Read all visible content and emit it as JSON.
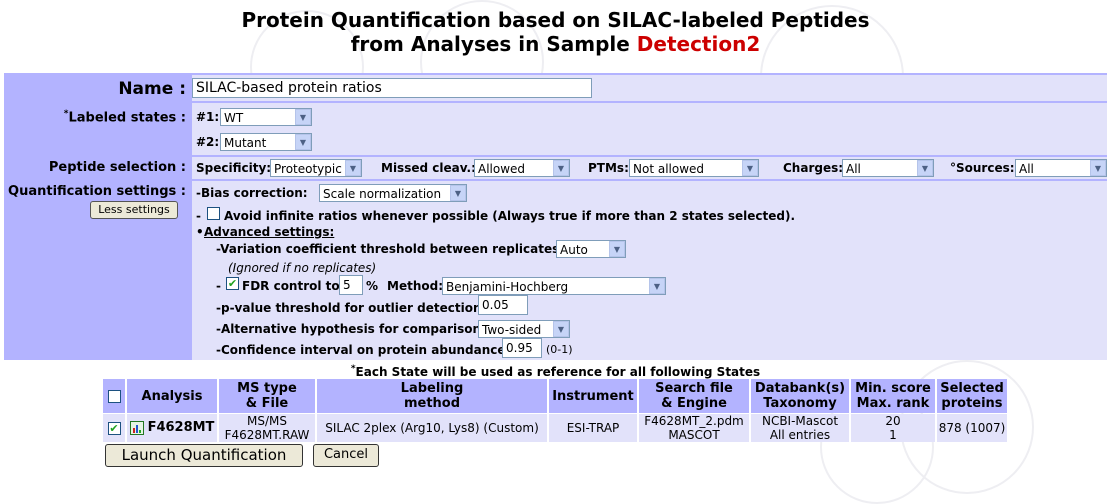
{
  "title": {
    "line1": "Protein Quantification based on SILAC-labeled Peptides",
    "line2_prefix": "from Analyses in Sample ",
    "sample_name": "Detection2"
  },
  "name_row": {
    "label": "Name :",
    "value": "SILAC-based protein ratios"
  },
  "labeled_states": {
    "label_star": "*",
    "label": "Labeled states :",
    "state1_label": "#1:",
    "state1_value": "WT",
    "state2_label": "#2:",
    "state2_value": "Mutant"
  },
  "peptide_selection": {
    "label": "Peptide selection :",
    "specificity_label": "Specificity:",
    "specificity_value": "Proteotypic",
    "missed_label": "Missed cleav.:",
    "missed_value": "Allowed",
    "ptms_label": "PTMs:",
    "ptms_value": "Not allowed",
    "charges_label": "Charges:",
    "charges_value": "All",
    "sources_label": "°Sources:",
    "sources_value": "All"
  },
  "quant_settings": {
    "label": "Quantification settings :",
    "less_settings": "Less settings",
    "bias_label": "-Bias correction:",
    "bias_value": "Scale normalization",
    "avoid_prefix": "-",
    "avoid_label": "Avoid infinite ratios whenever possible (Always true if more than 2 states selected).",
    "advanced_bullet": "•",
    "advanced_label": "Advanced settings:",
    "variation_label": "-Variation coefficient threshold between replicates:",
    "variation_value": "Auto",
    "ignored_note": "(Ignored if no replicates)",
    "fdr_prefix": "-",
    "fdr_label": "FDR control to",
    "fdr_value": "5",
    "fdr_unit": "%",
    "method_label": "Method:",
    "method_value": "Benjamini-Hochberg",
    "pvalue_label": "-p-value threshold for outlier detection:",
    "pvalue_value": "0.05",
    "alt_label": "-Alternative hypothesis for comparison:",
    "alt_value": "Two-sided",
    "ci_label": "-Confidence interval on protein abundance:",
    "ci_value": "0.95",
    "ci_range": "(0-1)"
  },
  "table": {
    "note_star": "*",
    "note": "Each State will be used as reference for all following States",
    "headers": {
      "analysis": "Analysis",
      "ms_type_1": "MS type",
      "ms_type_2": "& File",
      "labeling_1": "Labeling",
      "labeling_2": "method",
      "instrument": "Instrument",
      "search_1": "Search file",
      "search_2": "& Engine",
      "databank_1": "Databank(s)",
      "databank_2": "Taxonomy",
      "score_1": "Min. score",
      "score_2": "Max. rank",
      "selected_1": "Selected",
      "selected_2": "proteins"
    },
    "row": {
      "analysis": "F4628MT",
      "ms_type": "MS/MS",
      "ms_file": "F4628MT.RAW",
      "labeling": "SILAC 2plex (Arg10, Lys8) (Custom)",
      "instrument": "ESI-TRAP",
      "search_file": "F4628MT_2.pdm",
      "engine": "MASCOT",
      "databank": "NCBI-Mascot",
      "taxonomy": "All entries",
      "min_score": "20",
      "max_rank": "1",
      "selected": "878 (1007)"
    }
  },
  "buttons": {
    "launch": "Launch Quantification",
    "cancel": "Cancel"
  },
  "icons": [
    "chart-icon",
    "dropdown-arrow-icon",
    "checkbox-icon"
  ]
}
